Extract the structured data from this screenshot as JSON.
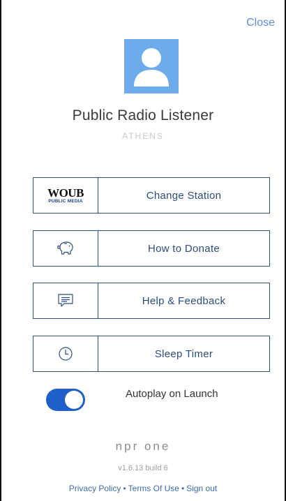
{
  "header": {
    "close_label": "Close"
  },
  "profile": {
    "name": "Public Radio Listener",
    "location": "ATHENS"
  },
  "menu": [
    {
      "label": "Change Station",
      "icon": "station-logo",
      "logo_text": "WOUB",
      "logo_subtext": "PUBLIC MEDIA"
    },
    {
      "label": "How to Donate",
      "icon": "piggy-bank-icon"
    },
    {
      "label": "Help & Feedback",
      "icon": "message-icon"
    },
    {
      "label": "Sleep Timer",
      "icon": "clock-icon"
    }
  ],
  "autoplay": {
    "label": "Autoplay on Launch",
    "enabled": true
  },
  "brand": {
    "name": "npr one"
  },
  "version": "v1.6.13 build 6",
  "footer": {
    "privacy": "Privacy Policy",
    "separator": "•",
    "terms": "Terms Of Use",
    "signout": "Sign out"
  },
  "colors": {
    "accent": "#5a8ed8",
    "button_border": "#2c4f86",
    "toggle_on": "#1f5fc9",
    "avatar_bg": "#6eabea"
  }
}
